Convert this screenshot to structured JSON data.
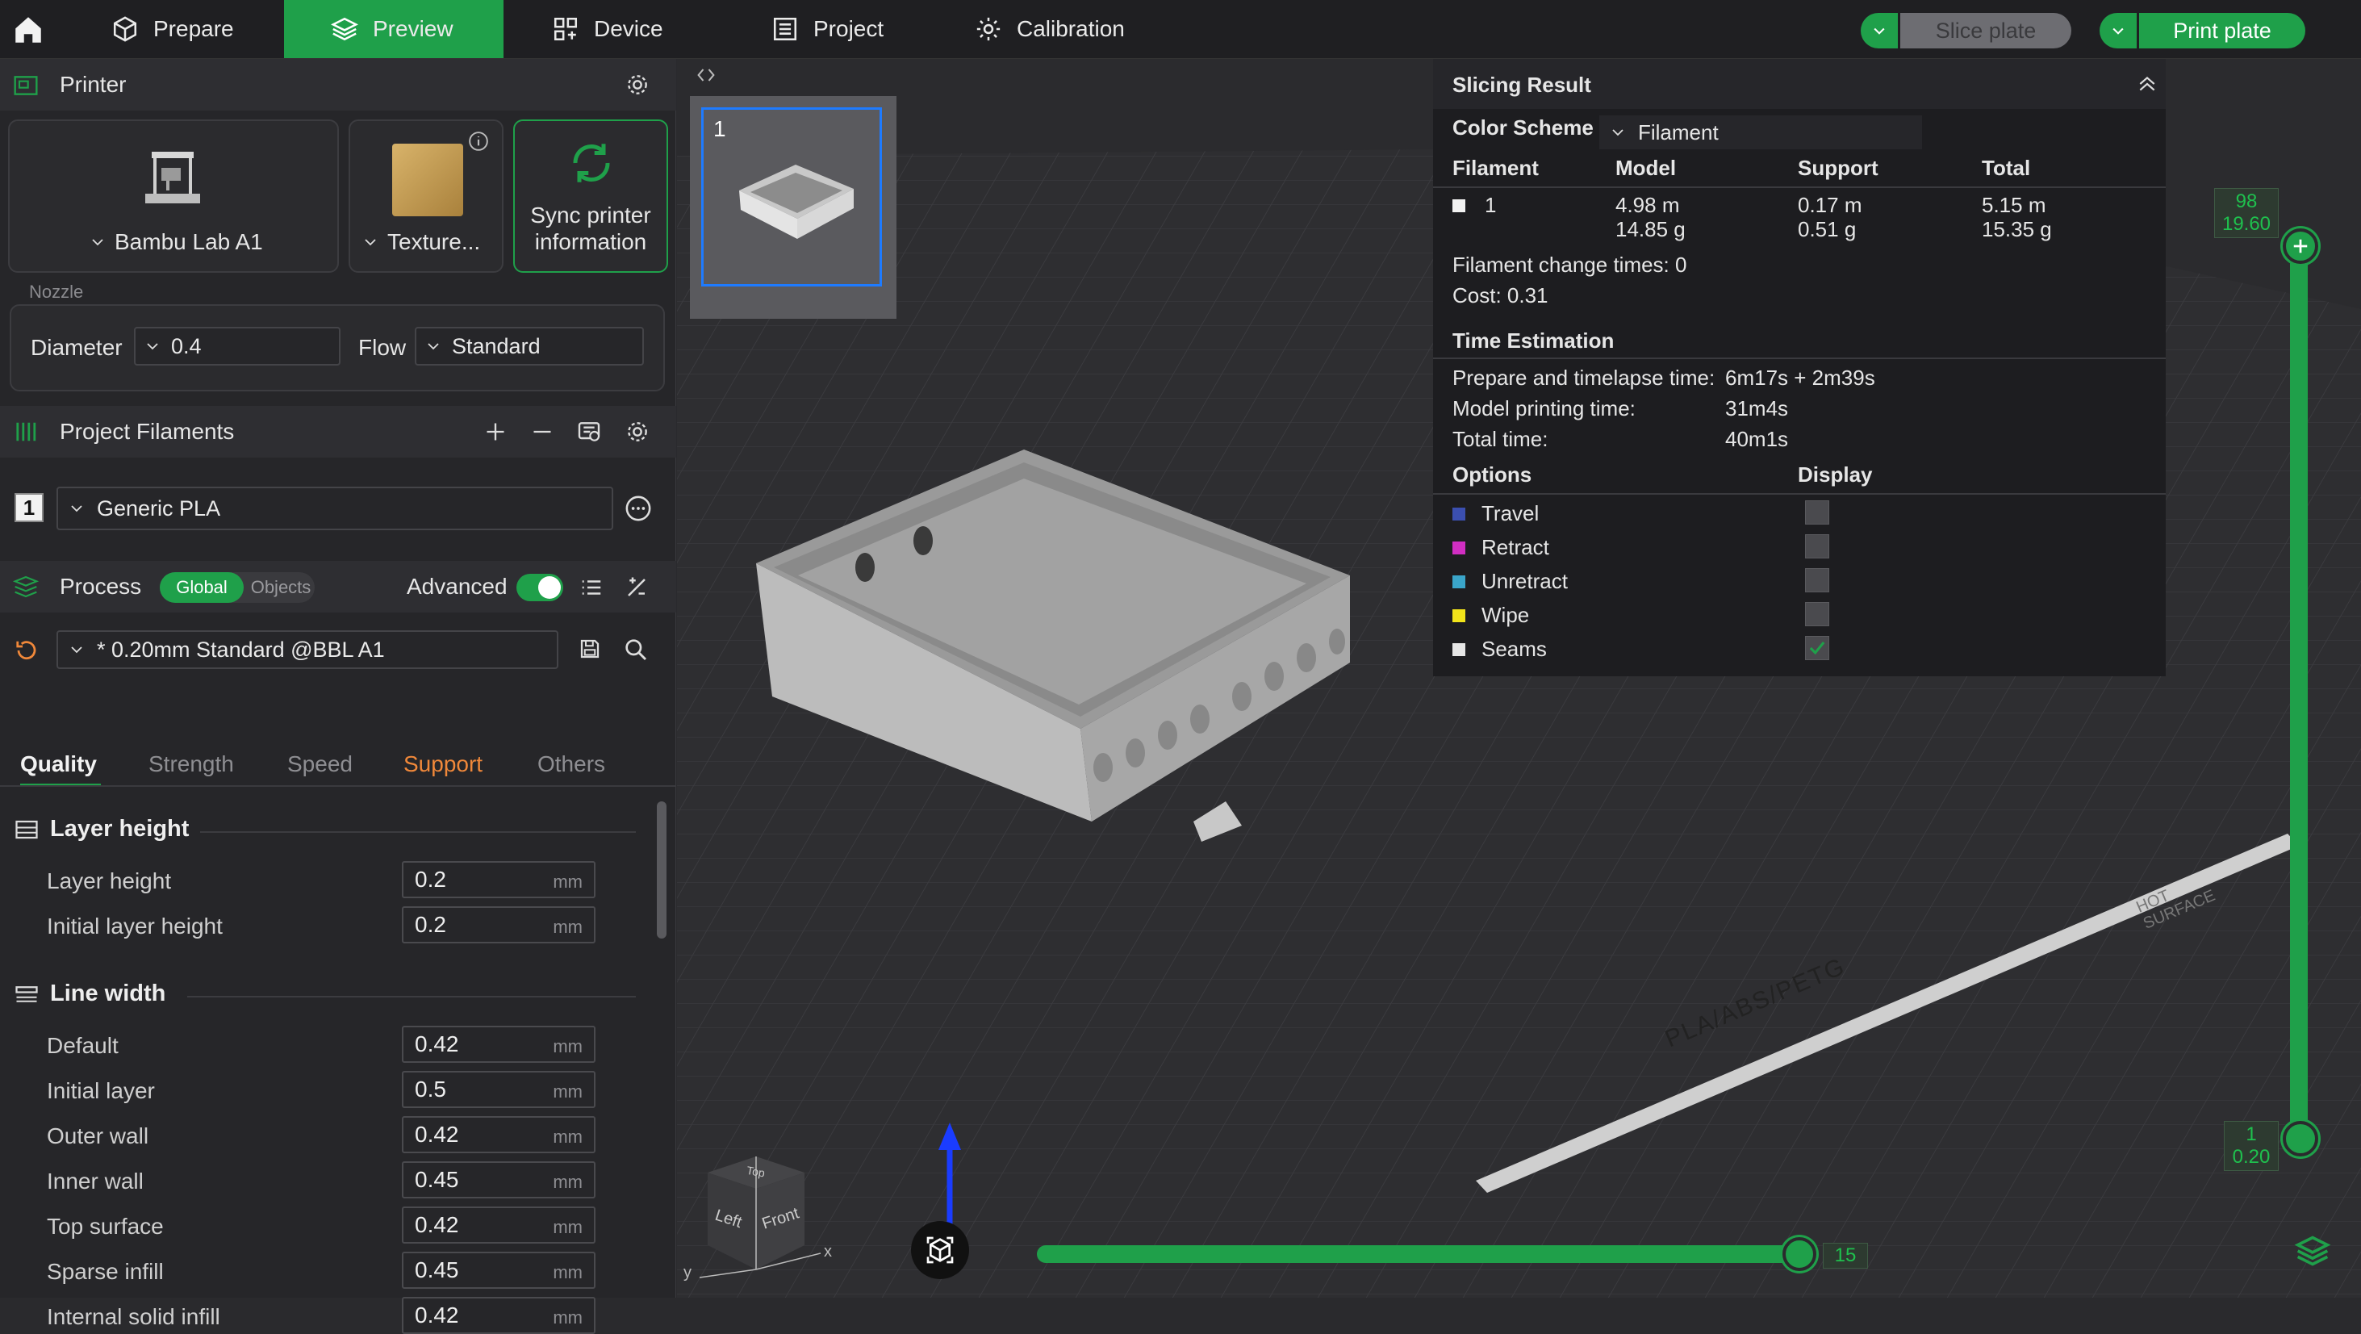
{
  "topbar": {
    "tabs": [
      {
        "label": "Prepare",
        "icon": "cube-icon"
      },
      {
        "label": "Preview",
        "icon": "layers-icon",
        "active": true
      },
      {
        "label": "Device",
        "icon": "device-icon"
      },
      {
        "label": "Project",
        "icon": "list-icon"
      },
      {
        "label": "Calibration",
        "icon": "gear-icon"
      }
    ],
    "slice_plate": "Slice plate",
    "print_plate": "Print plate"
  },
  "printer": {
    "title": "Printer",
    "printer_name": "Bambu Lab A1",
    "plate_name": "Texture...",
    "sync_label_1": "Sync printer",
    "sync_label_2": "information",
    "nozzle_label": "Nozzle",
    "diameter_label": "Diameter",
    "diameter_value": "0.4",
    "flow_label": "Flow",
    "flow_value": "Standard"
  },
  "filaments": {
    "title": "Project Filaments",
    "items": [
      {
        "index": "1",
        "name": "Generic PLA"
      }
    ]
  },
  "process": {
    "title": "Process",
    "global": "Global",
    "objects": "Objects",
    "advanced": "Advanced",
    "advanced_on": true,
    "profile": "* 0.20mm Standard @BBL A1",
    "tabs": [
      "Quality",
      "Strength",
      "Speed",
      "Support",
      "Others"
    ],
    "active_tab": "Quality",
    "groups": [
      {
        "title": "Layer height",
        "rows": [
          {
            "label": "Layer height",
            "value": "0.2",
            "unit": "mm"
          },
          {
            "label": "Initial layer height",
            "value": "0.2",
            "unit": "mm"
          }
        ]
      },
      {
        "title": "Line width",
        "rows": [
          {
            "label": "Default",
            "value": "0.42",
            "unit": "mm"
          },
          {
            "label": "Initial layer",
            "value": "0.5",
            "unit": "mm"
          },
          {
            "label": "Outer wall",
            "value": "0.42",
            "unit": "mm"
          },
          {
            "label": "Inner wall",
            "value": "0.45",
            "unit": "mm"
          },
          {
            "label": "Top surface",
            "value": "0.42",
            "unit": "mm"
          },
          {
            "label": "Sparse infill",
            "value": "0.45",
            "unit": "mm"
          },
          {
            "label": "Internal solid infill",
            "value": "0.42",
            "unit": "mm"
          }
        ]
      }
    ]
  },
  "plate": {
    "number": "1"
  },
  "slicing_result": {
    "title": "Slicing Result",
    "color_scheme_label": "Color Scheme",
    "color_scheme_value": "Filament",
    "columns": [
      "Filament",
      "Model",
      "Support",
      "Total"
    ],
    "rows": [
      {
        "filament": "1",
        "model_m": "4.98 m",
        "model_g": "14.85 g",
        "support_m": "0.17 m",
        "support_g": "0.51 g",
        "total_m": "5.15 m",
        "total_g": "15.35 g"
      }
    ],
    "change_times": "Filament change times:  0",
    "cost": "Cost:  0.31",
    "time_title": "Time Estimation",
    "prepare_label": "Prepare and timelapse time:",
    "prepare_value": "6m17s + 2m39s",
    "model_time_label": "Model printing time:",
    "model_time_value": "31m4s",
    "total_time_label": "Total time:",
    "total_time_value": "40m1s",
    "options_label": "Options",
    "display_label": "Display",
    "options": [
      {
        "label": "Travel",
        "color": "#3b4fb0",
        "checked": false
      },
      {
        "label": "Retract",
        "color": "#d12ec2",
        "checked": false
      },
      {
        "label": "Unretract",
        "color": "#3aa5c9",
        "checked": false
      },
      {
        "label": "Wipe",
        "color": "#f2e41a",
        "checked": false
      },
      {
        "label": "Seams",
        "color": "#e6e6e6",
        "checked": true
      }
    ]
  },
  "layer_slider": {
    "top_layer": "98",
    "top_height": "19.60",
    "bottom_layer": "1",
    "bottom_height": "0.20"
  },
  "move_slider": {
    "value": "15"
  },
  "bed_label": "PLA/ABS/PETG",
  "bed_warning_1": "HOT",
  "bed_warning_2": "SURFACE",
  "gizmo": {
    "top": "Top",
    "left": "Left",
    "front": "Front",
    "x": "x",
    "y": "y"
  },
  "colors": {
    "accent": "#1fa04a",
    "support_tab": "#f0883a"
  }
}
